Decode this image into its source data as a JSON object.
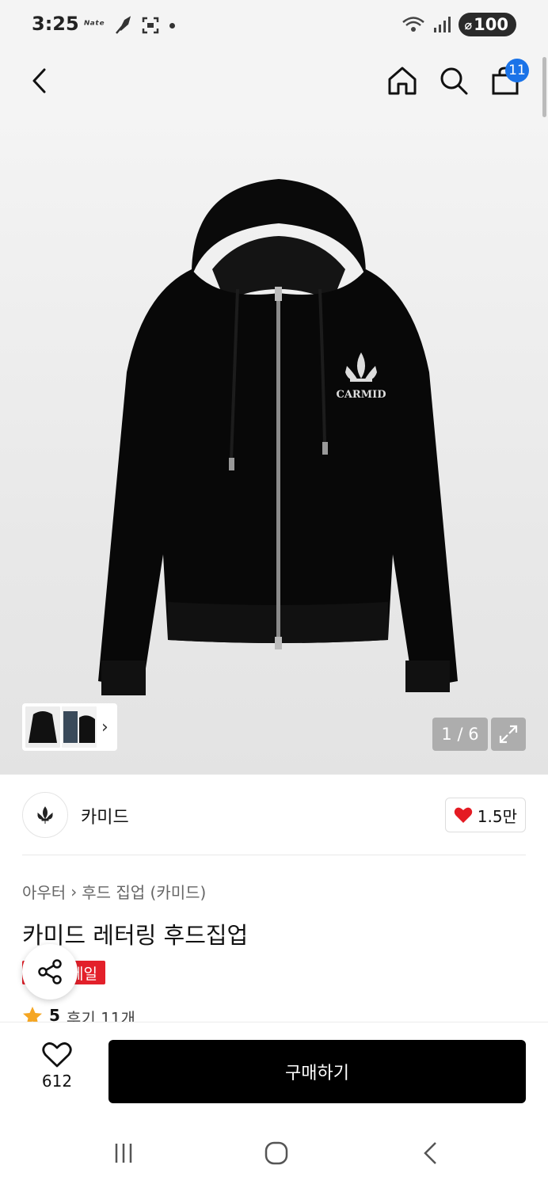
{
  "status_bar": {
    "time": "3:25",
    "battery": "100"
  },
  "header": {
    "cart_count": "11"
  },
  "gallery": {
    "page_indicator": "1 / 6",
    "thumbnail_arrow": "›"
  },
  "brand": {
    "name": "카미드",
    "likes": "1.5만"
  },
  "product": {
    "breadcrumb": [
      "아우터",
      "후드 집업 (카미드)"
    ],
    "breadcrumb_separator": "›",
    "title": "카미드 레터링 후드집업",
    "sale_badge": "세일",
    "rating": "5",
    "reviews": "후기 11개"
  },
  "bottom_bar": {
    "wish_count": "612",
    "buy_label": "구매하기"
  },
  "colors": {
    "accent_blue": "#1a73e8",
    "sale_red": "#e3202a",
    "heart_red": "#e41b23",
    "star": "#f5a623",
    "buy_bg": "#000000"
  },
  "icons": {
    "back": "chevron-left-icon",
    "home": "home-icon",
    "search": "search-icon",
    "cart": "shopping-bag-icon",
    "expand": "expand-icon",
    "share": "share-icon",
    "wish": "heart-outline-icon",
    "like": "heart-filled-icon"
  }
}
